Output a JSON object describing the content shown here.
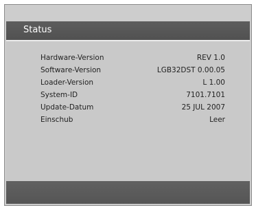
{
  "screen": {
    "title": "Status"
  },
  "status": {
    "rows": [
      {
        "label": "Hardware-Version",
        "value": "REV 1.0"
      },
      {
        "label": "Software-Version",
        "value": "LGB32DST 0.00.05"
      },
      {
        "label": "Loader-Version",
        "value": "L 1.00"
      },
      {
        "label": "System-ID",
        "value": "7101.7101"
      },
      {
        "label": "Update-Datum",
        "value": "25 JUL 2007"
      },
      {
        "label": "Einschub",
        "value": "Leer"
      }
    ]
  }
}
